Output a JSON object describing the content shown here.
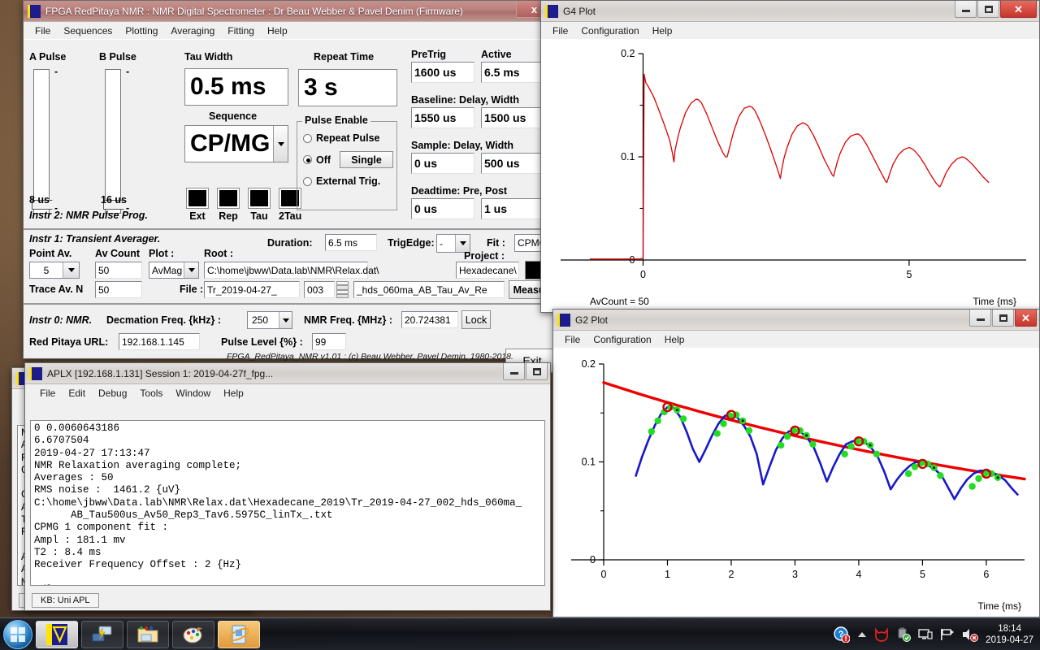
{
  "desktop": {
    "background_hex": "#5a4332"
  },
  "nmr_window": {
    "title": "FPGA RedPitaya NMR : NMR Digital Spectrometer : Dr Beau Webber & Pavel Denim (Firmware)",
    "icon": "aplx-icon",
    "close_label": "x",
    "menu": [
      "File",
      "Sequences",
      "Plotting",
      "Averaging",
      "Fitting",
      "Help"
    ],
    "pulse": {
      "a_label": "A Pulse",
      "b_label": "B Pulse",
      "a_value": "8 us",
      "b_value": "16 us",
      "tick_top": "-",
      "tick_bottom": "-"
    },
    "tau": {
      "label": "Tau Width",
      "value": "0.5 ms"
    },
    "sequence": {
      "label": "Sequence",
      "value": "CP/MG"
    },
    "repeat_time": {
      "label": "Repeat Time",
      "value": "3 s"
    },
    "pulse_enable": {
      "title": "Pulse Enable",
      "options": [
        "Repeat Pulse",
        "Off",
        "External Trig."
      ],
      "selected": "Off",
      "single_button": "Single"
    },
    "timing": {
      "pretrig_label": "PreTrig",
      "pretrig_value": "1600 us",
      "active_label": "Active",
      "active_value": "6.5 ms",
      "baseline_label": "Baseline: Delay, Width",
      "baseline_delay": "1550 us",
      "baseline_width": "1500 us",
      "sample_label": "Sample: Delay, Width",
      "sample_delay": "0 us",
      "sample_width": "500 us",
      "deadtime_label": "Deadtime: Pre, Post",
      "deadtime_pre": "0 us",
      "deadtime_post": "1 us"
    },
    "leds": [
      "Ext",
      "Rep",
      "Tau",
      "2Tau"
    ],
    "instr2_label": "Instr 2: NMR Pulse Prog.",
    "instr1": {
      "label": "Instr 1: Transient Averager.",
      "point_av_label": "Point Av.",
      "point_av_value": "5",
      "av_count_label": "Av Count",
      "av_count_value": "50",
      "plot_label": "Plot :",
      "plot_value": "AvMag",
      "root_label": "Root :",
      "root_value": "C:\\home\\jbww\\Data.lab\\NMR\\Relax.dat\\",
      "trace_av_label": "Trace Av. N",
      "trace_av_value": "50",
      "file_label": "File :",
      "file_value": "Tr_2019-04-27_",
      "file_index": "003",
      "file_suffix": "_hds_060ma_AB_Tau_Av_Re",
      "measure_button": "Measure",
      "duration_label": "Duration:",
      "duration_value": "6.5 ms",
      "trigedge_label": "TrigEdge:",
      "trigedge_value": "-",
      "fit_label": "Fit :",
      "fit_value": "CPMG",
      "project_label": "Project :",
      "project_value": "Hexadecane\\"
    },
    "instr0": {
      "label": "Instr 0: NMR.",
      "decimation_label": "Decmation Freq. {kHz} :",
      "decimation_value": "250",
      "nmr_freq_label": "NMR Freq. {MHz} :",
      "nmr_freq_value": "20.724381",
      "lock_button": "Lock",
      "exit_button": "Exit",
      "url_label": "Red Pitaya URL:",
      "url_value": "192.168.1.145",
      "pulse_level_label": "Pulse Level {%} :",
      "pulse_level_value": "99",
      "footer": "FPGA_RedPitaya_NMR v1.01 : (c) Beau Webber, Pavel Demin, 1980-2018."
    }
  },
  "aplx_window": {
    "title": "APLX [192.168.1.131] Session 1: 2019-04-27f_fpg...",
    "menu": [
      "File",
      "Edit",
      "Debug",
      "Tools",
      "Window",
      "Help"
    ],
    "console_text": "0 0.0060643186\n6.6707504\n2019-04-27 17:13:47\nNMR Relaxation averaging complete;\nAverages : 50\nRMS noise :  1461.2 {uV}\nC:\\home\\jbww\\Data.lab\\NMR\\Relax.dat\\Hexadecane_2019\\Tr_2019-04-27_002_hds_060ma_\n      AB_Tau500us_Av50_Rep3_Tav6.5975C_linTx_.txt\nCPMG 1 component fit :\nAmpl : 181.1 mv\nT2 : 8.4 ms\nReceiver Frequency Offset : 2 {Hz}\n\nIdle",
    "status": "KB: Uni APL",
    "minimize_glyph": "_",
    "maximize_glyph": "□"
  },
  "aplx_window_behind": {
    "console_text": "N\nA\nR\nC\n\nC\nA\nT\nR\n\nA\nA\nM\n5",
    "status": "K"
  },
  "g4_plot": {
    "title": "G4 Plot",
    "menu": [
      "File",
      "Configuration",
      "Help"
    ],
    "footer_left": "AvCount = 50",
    "footer_right": "Time {ms}"
  },
  "g2_plot": {
    "title": "G2 Plot",
    "menu": [
      "File",
      "Configuration",
      "Help"
    ],
    "footer_right": "Time {ms}"
  },
  "chart_data": [
    {
      "id": "g4",
      "type": "line",
      "title": "G4 Plot",
      "xlabel": "Time {ms}",
      "ylabel": "",
      "xlim": [
        -1.0,
        7.2
      ],
      "ylim": [
        0,
        0.2
      ],
      "xticks": [
        0,
        5
      ],
      "yticks": [
        0,
        0.1,
        0.2
      ],
      "annotation": "AvCount = 50",
      "series": [
        {
          "name": "CPMG echo train (AvMag)",
          "color": "#dd0000",
          "x": [
            -1.0,
            -0.5,
            -0.2,
            -0.05,
            0.0,
            0.02,
            0.05,
            0.1,
            0.2,
            0.3,
            0.4,
            0.5,
            0.55,
            0.58,
            0.6,
            0.65,
            0.7,
            0.8,
            0.9,
            1.0,
            1.05,
            1.1,
            1.2,
            1.3,
            1.4,
            1.5,
            1.55,
            1.58,
            1.6,
            1.65,
            1.7,
            1.8,
            1.9,
            2.0,
            2.05,
            2.1,
            2.2,
            2.3,
            2.4,
            2.5,
            2.55,
            2.58,
            2.6,
            2.65,
            2.7,
            2.8,
            2.9,
            3.0,
            3.05,
            3.1,
            3.2,
            3.3,
            3.4,
            3.5,
            3.55,
            3.58,
            3.6,
            3.65,
            3.7,
            3.8,
            3.9,
            4.0,
            4.05,
            4.1,
            4.2,
            4.3,
            4.4,
            4.5,
            4.55,
            4.58,
            4.6,
            4.65,
            4.7,
            4.8,
            4.9,
            5.0,
            5.05,
            5.1,
            5.2,
            5.3,
            5.4,
            5.5,
            5.55,
            5.58,
            5.6,
            5.65,
            5.7,
            5.8,
            5.9,
            6.0,
            6.05,
            6.1,
            6.2,
            6.3,
            6.4,
            6.5
          ],
          "y": [
            0.001,
            0.001,
            0.001,
            0.001,
            0.002,
            0.18,
            0.172,
            0.168,
            0.158,
            0.145,
            0.131,
            0.116,
            0.104,
            0.095,
            0.106,
            0.118,
            0.128,
            0.143,
            0.152,
            0.156,
            0.155,
            0.152,
            0.141,
            0.128,
            0.115,
            0.104,
            0.1,
            0.1,
            0.104,
            0.114,
            0.124,
            0.139,
            0.147,
            0.149,
            0.148,
            0.145,
            0.134,
            0.121,
            0.107,
            0.092,
            0.084,
            0.079,
            0.086,
            0.099,
            0.108,
            0.122,
            0.13,
            0.133,
            0.132,
            0.13,
            0.121,
            0.11,
            0.098,
            0.088,
            0.083,
            0.081,
            0.085,
            0.095,
            0.103,
            0.114,
            0.12,
            0.122,
            0.122,
            0.12,
            0.112,
            0.102,
            0.092,
            0.082,
            0.077,
            0.075,
            0.078,
            0.086,
            0.093,
            0.102,
            0.107,
            0.109,
            0.108,
            0.106,
            0.1,
            0.092,
            0.083,
            0.075,
            0.072,
            0.071,
            0.073,
            0.079,
            0.085,
            0.093,
            0.098,
            0.1,
            0.099,
            0.097,
            0.092,
            0.086,
            0.08,
            0.075
          ]
        }
      ]
    },
    {
      "id": "g2",
      "type": "line",
      "title": "G2 Plot",
      "xlabel": "Time {ms}",
      "ylabel": "",
      "xlim": [
        0,
        6.6
      ],
      "ylim": [
        0,
        0.2
      ],
      "xticks": [
        0,
        1,
        2,
        3,
        4,
        5,
        6
      ],
      "yticks": [
        0,
        0.1,
        0.2
      ],
      "fit": {
        "label": "CPMG 1 component fit",
        "amplitude_mv": 181.1,
        "t2_ms": 8.4,
        "color": "#ee0000"
      },
      "series": [
        {
          "name": "Echo train",
          "color": "#1818cc",
          "x": [
            0.5,
            0.6,
            0.7,
            0.8,
            0.9,
            1.0,
            1.1,
            1.2,
            1.3,
            1.4,
            1.5,
            1.6,
            1.7,
            1.8,
            1.9,
            2.0,
            2.1,
            2.2,
            2.3,
            2.4,
            2.5,
            2.6,
            2.7,
            2.8,
            2.9,
            3.0,
            3.1,
            3.2,
            3.3,
            3.4,
            3.5,
            3.6,
            3.7,
            3.8,
            3.9,
            4.0,
            4.1,
            4.2,
            4.3,
            4.4,
            4.5,
            4.6,
            4.7,
            4.8,
            4.9,
            5.0,
            5.1,
            5.2,
            5.3,
            5.4,
            5.5,
            5.6,
            5.7,
            5.8,
            5.9,
            6.0,
            6.1,
            6.2,
            6.3,
            6.4,
            6.5
          ],
          "y": [
            0.085,
            0.105,
            0.122,
            0.137,
            0.149,
            0.156,
            0.155,
            0.146,
            0.131,
            0.113,
            0.1,
            0.113,
            0.127,
            0.139,
            0.147,
            0.149,
            0.145,
            0.137,
            0.126,
            0.108,
            0.077,
            0.095,
            0.112,
            0.124,
            0.131,
            0.133,
            0.13,
            0.124,
            0.114,
            0.098,
            0.08,
            0.095,
            0.108,
            0.118,
            0.121,
            0.122,
            0.12,
            0.114,
            0.105,
            0.09,
            0.072,
            0.082,
            0.09,
            0.096,
            0.1,
            0.099,
            0.096,
            0.092,
            0.086,
            0.074,
            0.062,
            0.073,
            0.082,
            0.088,
            0.091,
            0.091,
            0.089,
            0.086,
            0.081,
            0.073,
            0.066
          ]
        },
        {
          "name": "Echo tops (fit region)",
          "color": "#22dd22",
          "x": [
            0.75,
            0.85,
            0.95,
            1.05,
            1.15,
            1.25,
            1.78,
            1.88,
            1.98,
            2.08,
            2.18,
            2.28,
            2.78,
            2.88,
            2.98,
            3.08,
            3.18,
            3.28,
            3.78,
            3.88,
            3.98,
            4.08,
            4.18,
            4.28,
            4.78,
            4.88,
            4.98,
            5.08,
            5.18,
            5.28,
            5.78,
            5.88,
            5.98,
            6.08,
            6.18
          ],
          "y": [
            0.131,
            0.142,
            0.151,
            0.156,
            0.153,
            0.144,
            0.129,
            0.139,
            0.147,
            0.148,
            0.142,
            0.132,
            0.117,
            0.126,
            0.132,
            0.132,
            0.127,
            0.118,
            0.108,
            0.116,
            0.121,
            0.121,
            0.117,
            0.108,
            0.088,
            0.095,
            0.099,
            0.098,
            0.094,
            0.086,
            0.075,
            0.083,
            0.088,
            0.088,
            0.084
          ]
        }
      ],
      "markers": {
        "name": "Echo peak markers",
        "color": "#cc0000",
        "x": [
          1.0,
          2.0,
          3.0,
          4.0,
          5.0,
          6.0
        ],
        "y": [
          0.156,
          0.148,
          0.132,
          0.121,
          0.098,
          0.088
        ]
      }
    }
  ],
  "taskbar": {
    "items": [
      "start-orb",
      "aplx-app",
      "network-app",
      "explorer-app",
      "paint-app",
      "media-app"
    ],
    "active_item": "media-app",
    "tray_icons": [
      "help-icon",
      "show-hidden-icon",
      "antivirus-icon",
      "usb-icon",
      "display-icon",
      "flag-icon",
      "volume-muted-icon"
    ],
    "time": "18:14",
    "date": "2019-04-27"
  }
}
